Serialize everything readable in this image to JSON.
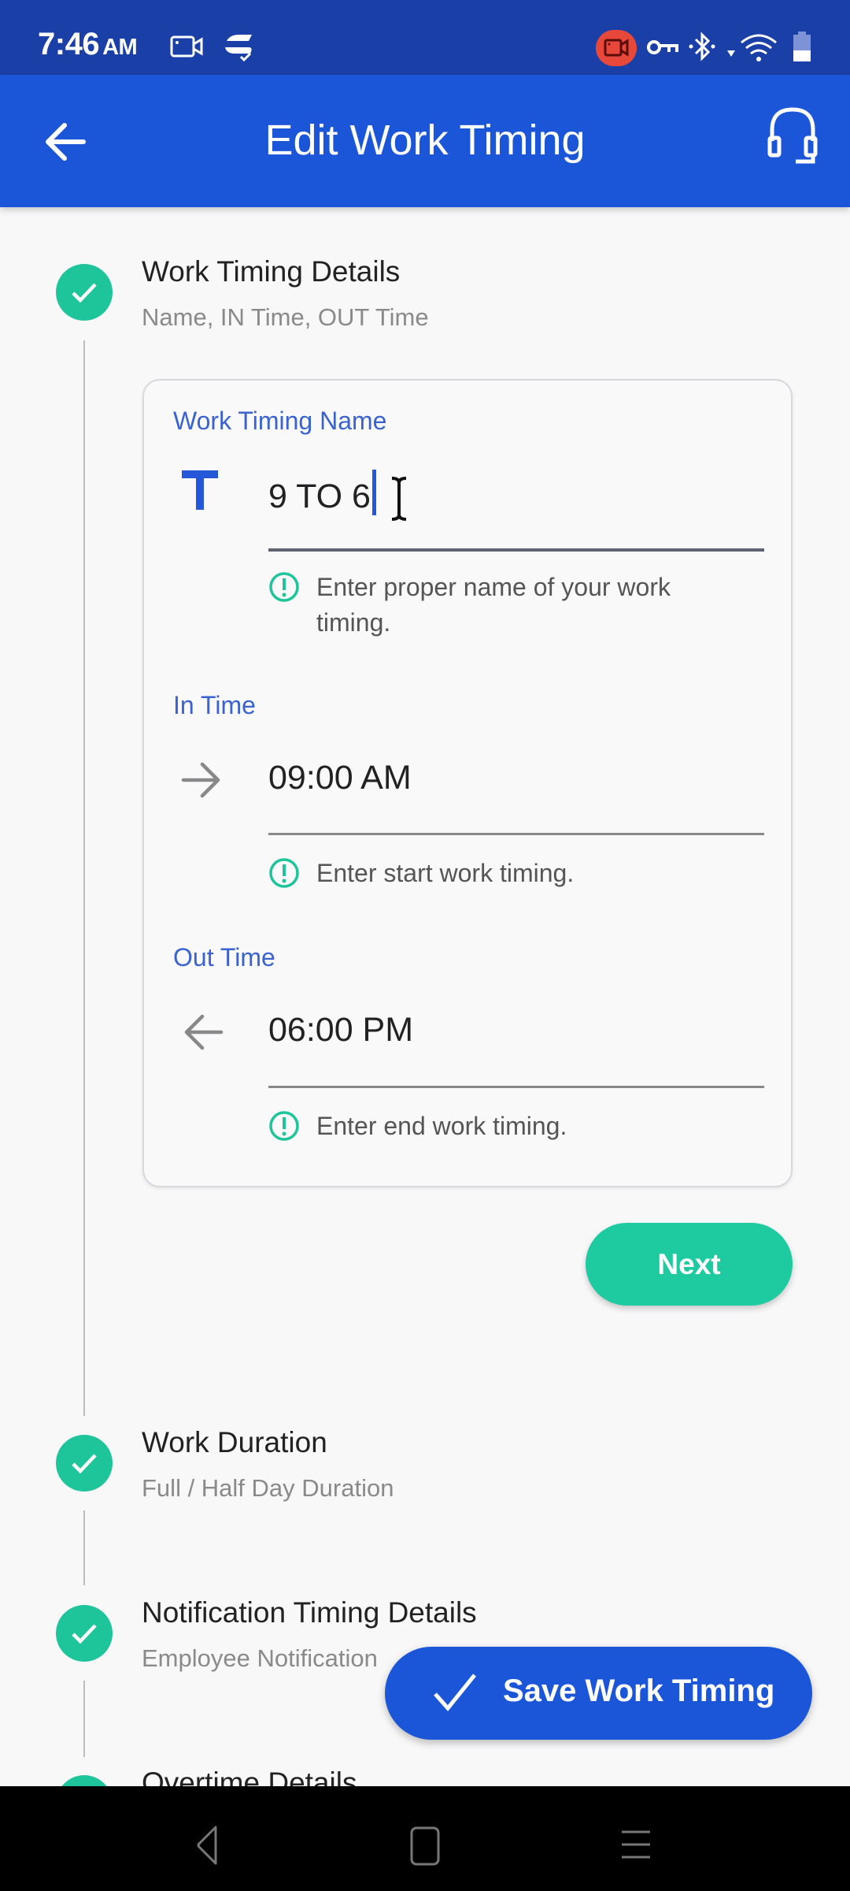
{
  "status_bar": {
    "time": "7:46",
    "ampm": "AM",
    "left_icons": [
      "screen-record-icon",
      "app-notification-icon"
    ],
    "right_icons": [
      "recording-indicator-icon",
      "vpn-key-icon",
      "bluetooth-icon",
      "wifi-icon",
      "battery-icon"
    ]
  },
  "app_bar": {
    "title": "Edit Work Timing",
    "back_icon": "arrow-left-icon",
    "support_icon": "headset-icon"
  },
  "steps": [
    {
      "title": "Work Timing Details",
      "subtitle": "Name, IN Time, OUT Time",
      "status": "completed",
      "expanded": true
    },
    {
      "title": "Work Duration",
      "subtitle": "Full / Half Day Duration",
      "status": "completed",
      "expanded": false
    },
    {
      "title": "Notification Timing Details",
      "subtitle": "Employee Notification",
      "status": "completed",
      "expanded": false
    },
    {
      "title": "Overtime Details",
      "subtitle": "",
      "status": "completed",
      "expanded": false
    }
  ],
  "form": {
    "name_field": {
      "label": "Work Timing Name",
      "value": "9 TO 6",
      "icon": "text-t-icon",
      "helper": "Enter proper name of your work timing."
    },
    "in_time_field": {
      "label": "In Time",
      "value": "09:00 AM",
      "icon": "arrow-right-icon",
      "helper": "Enter start work timing."
    },
    "out_time_field": {
      "label": "Out Time",
      "value": "06:00 PM",
      "icon": "arrow-left-icon",
      "helper": "Enter end work timing."
    },
    "next_label": "Next"
  },
  "save_button": {
    "label": "Save Work Timing",
    "icon": "check-icon"
  },
  "colors": {
    "primary": "#1c56d8",
    "status_bar": "#1a40a8",
    "success": "#1ecba0",
    "label": "#3a63d0"
  }
}
